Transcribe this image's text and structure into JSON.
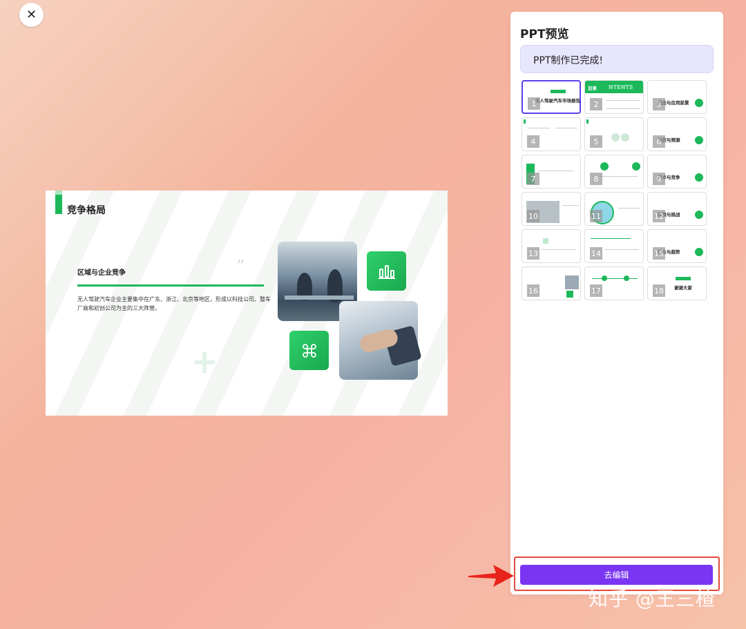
{
  "close_label": "✕",
  "slide": {
    "title": "竞争格局",
    "subtitle": "区域与企业竞争",
    "body": "无人驾驶汽车企业主要集中在广东、浙江、北京等地区，形成以科技公司、整车厂商和初创公司为主的三大阵营。",
    "quote_mark": "”",
    "tile1_icon": "bar-chart-icon",
    "tile2_icon": "command-icon"
  },
  "panel": {
    "title": "PPT预览",
    "status": "PPT制作已完成!",
    "thumbnails": [
      {
        "num": "1",
        "label": "无人驾驶汽车市场报告",
        "selected": true
      },
      {
        "num": "2",
        "label": "目录",
        "extra": "NTENTS"
      },
      {
        "num": "3",
        "label": "概念与应用前景"
      },
      {
        "num": "4",
        "label": ""
      },
      {
        "num": "5",
        "label": ""
      },
      {
        "num": "6",
        "label": "现状与预测"
      },
      {
        "num": "7",
        "label": ""
      },
      {
        "num": "8",
        "label": ""
      },
      {
        "num": "9",
        "label": "技术与竞争"
      },
      {
        "num": "10",
        "label": ""
      },
      {
        "num": "11",
        "label": ""
      },
      {
        "num": "12",
        "label": "政策与挑战"
      },
      {
        "num": "13",
        "label": ""
      },
      {
        "num": "14",
        "label": ""
      },
      {
        "num": "15",
        "label": "行业与趋势"
      },
      {
        "num": "16",
        "label": ""
      },
      {
        "num": "17",
        "label": ""
      },
      {
        "num": "18",
        "label": "谢谢大家"
      }
    ],
    "edit_button": "去编辑"
  },
  "watermark": "知乎 @王三楂",
  "colors": {
    "accent_green": "#1cb85a",
    "button_purple": "#7a35f2",
    "highlight_red": "#e24a3a"
  }
}
